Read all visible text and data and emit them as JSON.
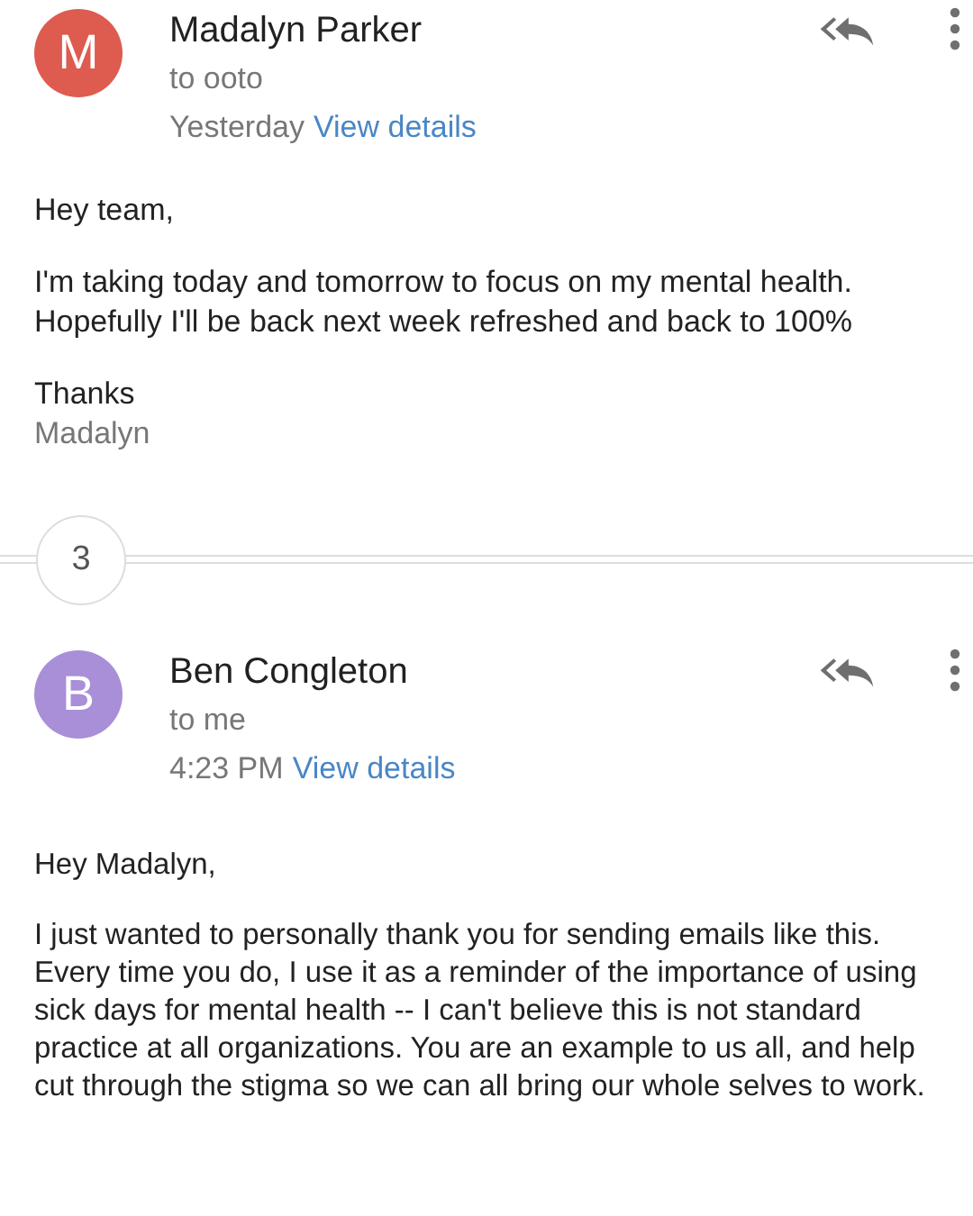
{
  "messages": [
    {
      "avatar_letter": "M",
      "color": "#dd5c4f",
      "sender": "Madalyn Parker",
      "recipient": "to ooto",
      "time": "Yesterday",
      "details_link": "View details",
      "greeting": "Hey team,",
      "paragraphs": [
        "I'm taking today and tomorrow to focus on my mental health. Hopefully I'll be back next week refreshed and back to 100%"
      ],
      "signoff": "Thanks",
      "signature": "Madalyn"
    },
    {
      "avatar_letter": "B",
      "color": "#a88fd8",
      "sender": "Ben Congleton",
      "recipient": "to me",
      "time": "4:23 PM",
      "details_link": "View details",
      "greeting": "Hey Madalyn,",
      "paragraphs": [
        "I just wanted to personally thank you for sending emails like this.  Every time you do, I use it as a reminder of the importance of using sick days for mental health -- I can't believe this is not standard practice at all organizations.  You are an example to us all, and help cut through the stigma so we can all bring our whole selves to work."
      ]
    }
  ],
  "collapsed_count": "3"
}
